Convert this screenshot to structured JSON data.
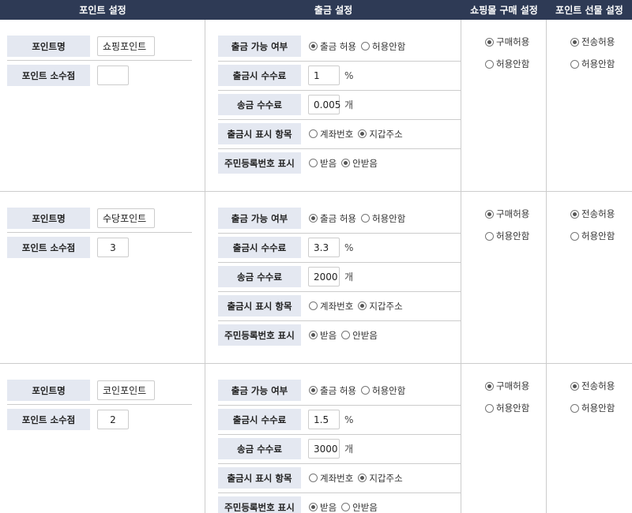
{
  "headers": [
    "포인트 설정",
    "출금 설정",
    "쇼핑몰 구매 설정",
    "포인트 선물 설정"
  ],
  "labels": {
    "point_name": "포인트명",
    "point_decimal": "포인트 소수점",
    "withdraw_allowed": "출금 가능 여부",
    "withdraw_fee": "출금시 수수료",
    "transfer_fee": "송금 수수료",
    "withdraw_display": "출금시 표시 항목",
    "resident_display": "주민등록번호 표시"
  },
  "options": {
    "withdraw_allow": "출금 허용",
    "withdraw_deny": "허용안함",
    "account_number": "계좌번호",
    "wallet_address": "지갑주소",
    "receive": "받음",
    "not_receive": "안받음",
    "purchase_allow": "구매허용",
    "purchase_deny": "허용안함",
    "gift_allow": "전송허용",
    "gift_deny": "허용안함"
  },
  "units": {
    "percent": "%",
    "count": "개"
  },
  "points": [
    {
      "name": "쇼핑포인트",
      "decimal": "",
      "withdraw": "allow",
      "fee": "1",
      "transfer_fee": "0.005",
      "display": "wallet",
      "resident": "not_receive",
      "purchase": "allow",
      "gift": "allow"
    },
    {
      "name": "수당포인트",
      "decimal": "3",
      "withdraw": "allow",
      "fee": "3.3",
      "transfer_fee": "2000",
      "display": "wallet",
      "resident": "receive",
      "purchase": "allow",
      "gift": "allow"
    },
    {
      "name": "코인포인트",
      "decimal": "2",
      "withdraw": "allow",
      "fee": "1.5",
      "transfer_fee": "3000",
      "display": "wallet",
      "resident": "receive",
      "purchase": "allow",
      "gift": "allow"
    }
  ]
}
